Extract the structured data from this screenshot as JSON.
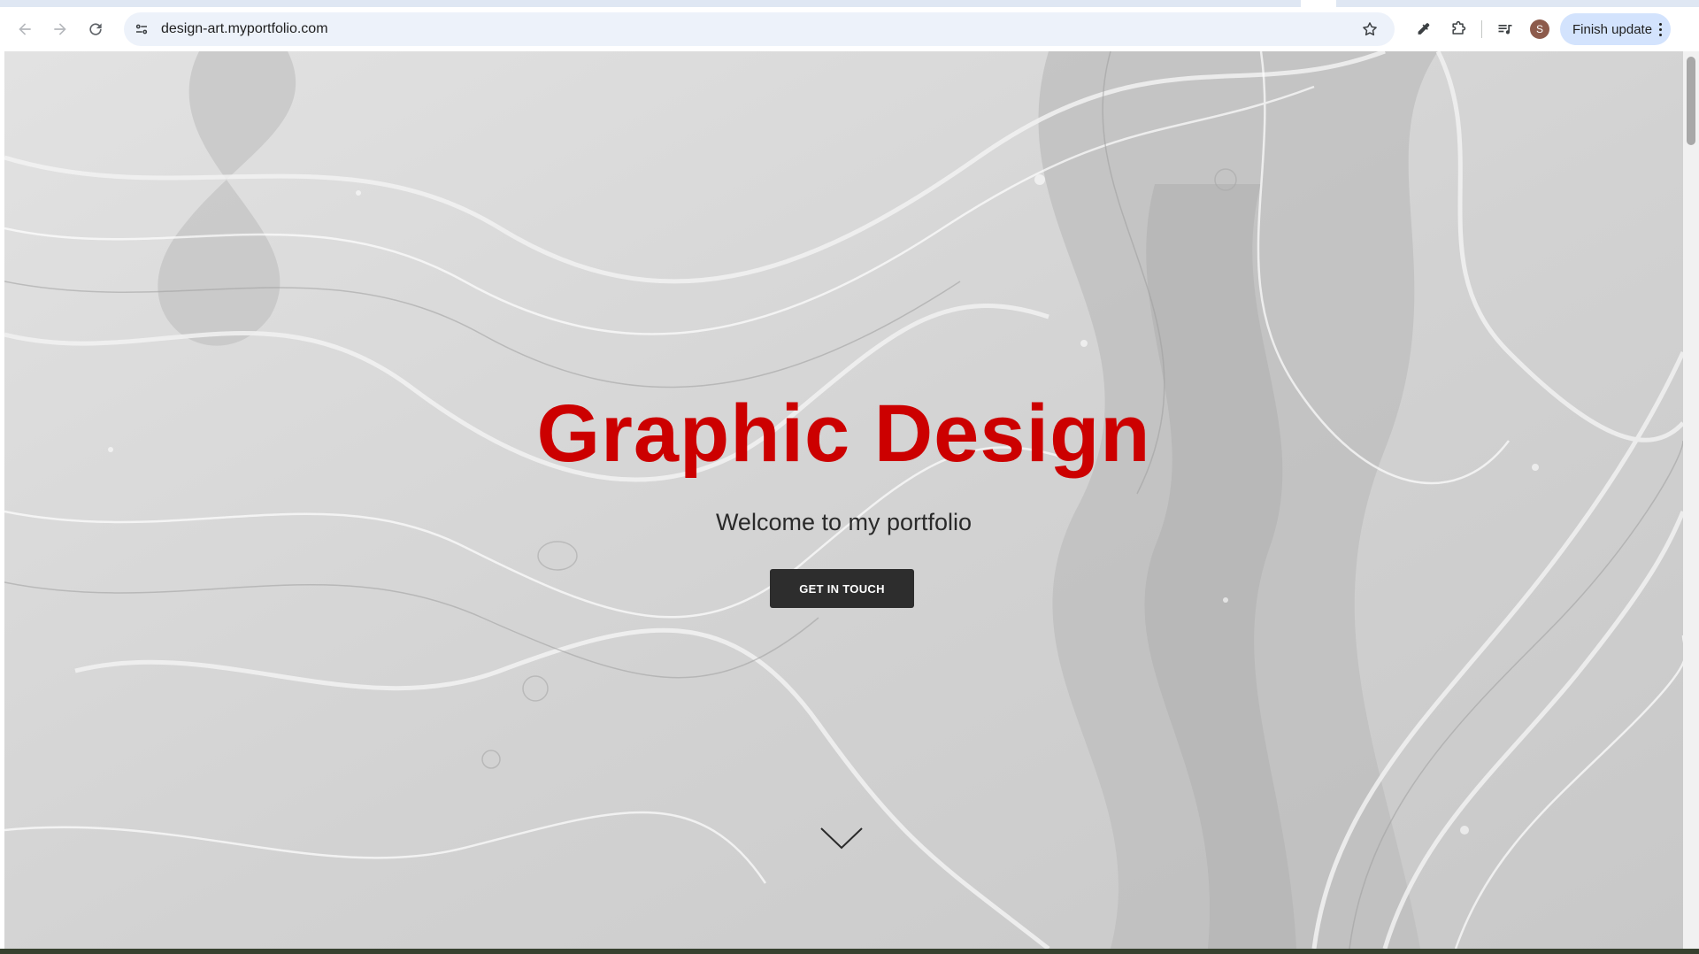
{
  "browser": {
    "url": "design-art.myportfolio.com",
    "update_label": "Finish update",
    "avatar_initial": "S"
  },
  "hero": {
    "title": "Graphic Design",
    "subtitle": "Welcome to my portfolio",
    "cta_label": "GET IN TOUCH"
  },
  "colors": {
    "title": "#cc0000",
    "button": "#2d2d2d",
    "background": "#d6d6d6"
  }
}
